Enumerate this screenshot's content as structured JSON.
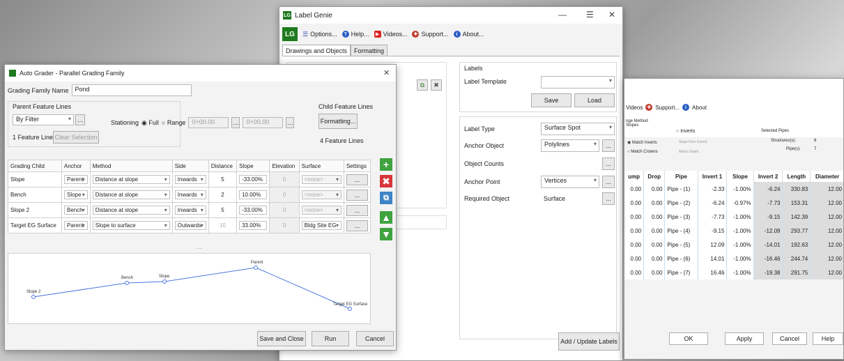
{
  "label_genie": {
    "title": "Label Genie",
    "logo": "LG",
    "menu": [
      {
        "label": "Options...",
        "icon": "list-icon"
      },
      {
        "label": "Help...",
        "icon": "help-icon"
      },
      {
        "label": "Videos...",
        "icon": "video-icon"
      },
      {
        "label": "Support...",
        "icon": "support-icon"
      },
      {
        "label": "About...",
        "icon": "info-icon"
      }
    ],
    "tabs": [
      "Drawings and Objects",
      "Formatting"
    ],
    "labels_section": "Labels",
    "label_template_label": "Label Template",
    "label_template_value": "",
    "save_button": "Save",
    "load_button": "Load",
    "label_type_label": "Label Type",
    "label_type_value": "Surface Spot",
    "anchor_object_label": "Anchor Object",
    "anchor_object_value": "Polylines",
    "object_counts_label": "Object Counts",
    "anchor_point_label": "Anchor Point",
    "anchor_point_value": "Vertices",
    "required_object_label": "Required Object",
    "required_object_value": "Surface",
    "more_button": "...",
    "add_update_button": "Add / Update Labels"
  },
  "auto_grader": {
    "title": "Auto Grader - Parallel Grading Family",
    "family_name_label": "Grading Family Name",
    "family_name_value": "Pond",
    "parent_section": "Parent Feature Lines",
    "filter_value": "By Filter",
    "stationing_label": "Stationing",
    "full_option": "Full",
    "range_option": "Range",
    "range_start": "0+00.00",
    "range_end": "0+00.00",
    "feature_lines_count": "1 Feature Lines",
    "clear_selection": "Clear Selection",
    "child_section": "Child Feature Lines",
    "formatting_button": "Formatting...",
    "child_count": "4 Feature Lines",
    "columns": [
      "Grading Child",
      "Anchor",
      "Method",
      "Side",
      "Distance",
      "Slope",
      "Elevation",
      "Surface",
      "Settings"
    ],
    "rows": [
      {
        "child": "Slope",
        "anchor": "Parent",
        "method": "Distance at slope",
        "side": "Inwards",
        "distance": "5",
        "slope": "-33.00%",
        "elevation": "0",
        "surface": "<none>",
        "settings": "..."
      },
      {
        "child": "Bench",
        "anchor": "Slope",
        "method": "Distance at slope",
        "side": "Inwards",
        "distance": "2",
        "slope": "10.00%",
        "elevation": "0",
        "surface": "<none>",
        "settings": "..."
      },
      {
        "child": "Slope 2",
        "anchor": "Bench",
        "method": "Distance at slope",
        "side": "Inwards",
        "distance": "5",
        "slope": "-33.00%",
        "elevation": "0",
        "surface": "<none>",
        "settings": "..."
      },
      {
        "child": "Target EG Surface",
        "anchor": "Parent",
        "method": "Slope to surface",
        "side": "Outwards",
        "distance": "10",
        "slope": "33.00%",
        "elevation": "0",
        "surface": "Bldg Site EG",
        "settings": "..."
      }
    ],
    "splitter": "....",
    "preview_labels": [
      "Slope 2",
      "Bench",
      "Slope",
      "Parent",
      "Target EG Surface"
    ],
    "save_close_button": "Save and Close",
    "run_button": "Run",
    "cancel_button": "Cancel"
  },
  "pipe_window": {
    "menu": [
      {
        "label": "Videos",
        "icon": "video-icon"
      },
      {
        "label": "Support...",
        "icon": "support-icon"
      },
      {
        "label": "About",
        "icon": "info-icon"
      }
    ],
    "method_label": "nge Method",
    "slopes_option": "Slopes",
    "inverts_option": "Inverts",
    "match_inverts": "Match Inverts",
    "match_crowns": "Match Crowns",
    "faded_option_1": "Slope from Inverts",
    "faded_option_2": "Match Depth",
    "selected_pipes_label": "Selected Pipes",
    "structures_label": "Structures(s):",
    "structures_value": "8",
    "pipes_label": "Pipe(s):",
    "pipes_value": "7",
    "columns": [
      "ump",
      "Drop",
      "Pipe",
      "Invert 1",
      "Slope",
      "Invert 2",
      "Length",
      "Diameter"
    ],
    "rows": [
      {
        "pipe": "Pipe - (1)",
        "invert1": "-2.33",
        "slope": "-1.00%",
        "invert2": "-6.24",
        "length": "330.83",
        "diameter": "12.00"
      },
      {
        "pipe": "Pipe - (2)",
        "invert1": "-6.24",
        "slope": "-0.97%",
        "invert2": "-7.73",
        "length": "153.31",
        "diameter": "12.00"
      },
      {
        "pipe": "Pipe - (3)",
        "invert1": "-7.73",
        "slope": "-1.00%",
        "invert2": "-9.15",
        "length": "142.39",
        "diameter": "12.00"
      },
      {
        "pipe": "Pipe - (4)",
        "invert1": "-9.15",
        "slope": "-1.00%",
        "invert2": "-12.09",
        "length": "293.77",
        "diameter": "12.00"
      },
      {
        "pipe": "Pipe - (5)",
        "invert1": "12.09",
        "slope": "-1.00%",
        "invert2": "-14.01",
        "length": "192.63",
        "diameter": "12.00"
      },
      {
        "pipe": "Pipe - (6)",
        "invert1": "14.01",
        "slope": "-1.00%",
        "invert2": "-16.46",
        "length": "244.74",
        "diameter": "12.00"
      },
      {
        "pipe": "Pipe - (7)",
        "invert1": "16.46",
        "slope": "-1.00%",
        "invert2": "-19.38",
        "length": "291.75",
        "diameter": "12.00"
      }
    ],
    "zero_value": "0.00",
    "ok_button": "OK",
    "apply_button": "Apply",
    "cancel_button": "Cancel",
    "help_button": "Help"
  }
}
